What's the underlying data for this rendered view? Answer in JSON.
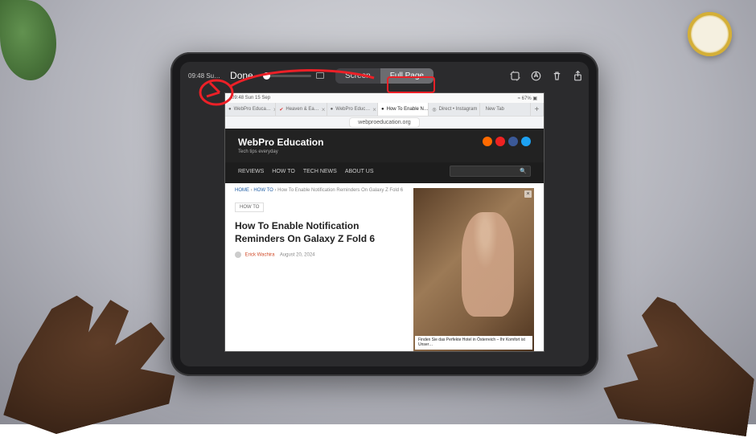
{
  "screenshot_editor": {
    "ipad_status_left": "09:48 Su…",
    "done_label": "Done",
    "tabs": {
      "screen": "Screen",
      "full_page": "Full Page",
      "active": "full_page"
    },
    "icons": [
      "crop-icon",
      "markup-icon",
      "delete-icon",
      "share-icon"
    ]
  },
  "safari": {
    "status_left": "09:48  Sun 15 Sep",
    "status_right": "≈ 67% ▣",
    "tabs": [
      {
        "label": "WebPro Educa…",
        "fav": "●"
      },
      {
        "label": "Heaven & Ea…",
        "fav": "✔"
      },
      {
        "label": "WebPro Educ…",
        "fav": "●"
      },
      {
        "label": "How To Enable N…",
        "fav": "●",
        "active": true
      },
      {
        "label": "Direct • Instagram",
        "fav": "◎"
      },
      {
        "label": "New Tab",
        "fav": ""
      }
    ],
    "url": "webproeducation.org"
  },
  "webpage": {
    "brand_title": "WebPro Education",
    "brand_sub": "Tech tips everyday",
    "nav": [
      "REVIEWS",
      "HOW TO",
      "TECH NEWS",
      "ABOUT US"
    ],
    "search_placeholder": "",
    "crumbs": {
      "home": "HOME",
      "sep": "›",
      "cat": "HOW TO",
      "title": "How To Enable Notification Reminders On Galaxy Z Fold 6"
    },
    "badge": "HOW TO",
    "article_title": "How To Enable Notification Reminders On Galaxy Z Fold 6",
    "author": "Erick Wachira",
    "date": "August 20, 2024",
    "ad_caption": "Finden Sie das Perfekte Hotel in Österreich – Ihr Komfort ist Unser…",
    "social_colors": [
      "#ff6a00",
      "#e22",
      "#3b5998",
      "#1da1f2"
    ]
  },
  "annotation": {
    "highlight": "Full Page",
    "circle_target": "Done"
  }
}
